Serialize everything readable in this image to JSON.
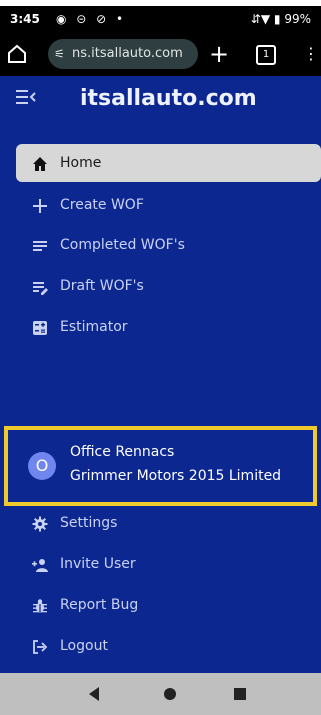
{
  "status_bar": {
    "time": "3:45",
    "left_icons": "◉ ⊝ ⊘ •",
    "right_icons": "⇵▼ ▮",
    "battery": "99%"
  },
  "browser": {
    "url": "ns.itsallauto.com",
    "tab_count": "1"
  },
  "drawer": {
    "brand": "itsallauto.com",
    "nav_items": [
      {
        "label": "Home",
        "icon": "home-icon",
        "active": true
      },
      {
        "label": "Create WOF",
        "icon": "plus-icon"
      },
      {
        "label": "Completed WOF's",
        "icon": "lines-icon"
      },
      {
        "label": "Draft WOF's",
        "icon": "edit-lines-icon"
      },
      {
        "label": "Estimator",
        "icon": "calculator-icon"
      }
    ],
    "user": {
      "initial": "O",
      "name": "Office Rennacs",
      "company": "Grimmer Motors 2015 Limited"
    },
    "bottom_items": [
      {
        "label": "Settings",
        "icon": "gear-icon"
      },
      {
        "label": "Invite User",
        "icon": "add-user-icon"
      },
      {
        "label": "Report Bug",
        "icon": "bug-icon"
      },
      {
        "label": "Logout",
        "icon": "logout-icon"
      }
    ]
  },
  "colors": {
    "drawer_bg": "#0c2790",
    "highlight_border": "#f0c92d",
    "active_item_bg": "#d7d7d7"
  }
}
